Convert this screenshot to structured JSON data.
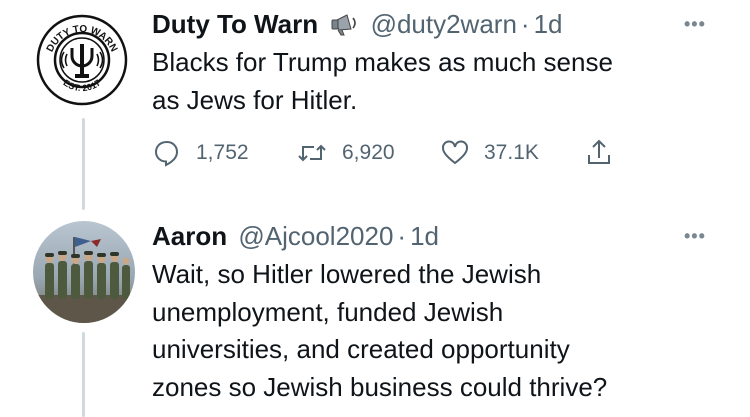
{
  "tweet1": {
    "display_name": "Duty To Warn",
    "badge_icon": "megaphone-icon",
    "handle": "@duty2warn",
    "separator": "·",
    "time": "1d",
    "text_lines": [
      "Blacks for Trump makes as much sense",
      "as Jews for Hitler."
    ],
    "avatar": {
      "icon": "logo-seal",
      "ring_text_top": "DUTY TO WARN",
      "ring_text_bottom": "EST. 2017"
    },
    "actions": {
      "replies": "1,752",
      "retweets": "6,920",
      "likes": "37.1K"
    }
  },
  "tweet2": {
    "display_name": "Aaron",
    "handle": "@Ajcool2020",
    "separator": "·",
    "time": "1d",
    "text_lines": [
      "Wait, so Hitler lowered the Jewish",
      "unemployment, funded Jewish",
      "universities, and created opportunity",
      "zones so Jewish business could thrive?"
    ],
    "avatar": {
      "icon": "soldiers-photo"
    }
  },
  "colors": {
    "text": "#0f1419",
    "secondary": "#536471",
    "thread_line": "#cfd9de"
  }
}
